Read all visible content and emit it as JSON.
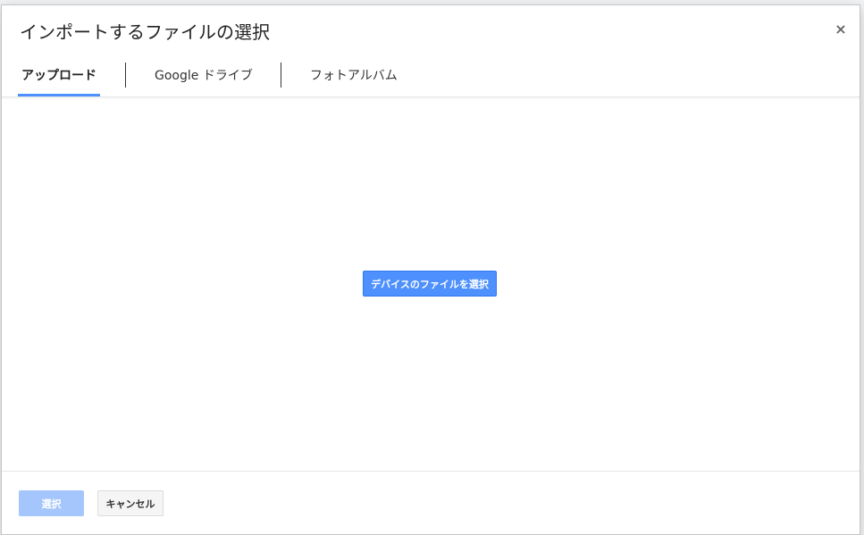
{
  "dialog": {
    "title": "インポートするファイルの選択",
    "close_label": "×",
    "tabs": [
      {
        "label": "アップロード",
        "active": true
      },
      {
        "label": "Google ドライブ",
        "active": false
      },
      {
        "label": "フォトアルバム",
        "active": false
      }
    ],
    "select_device_file_label": "デバイスのファイルを選択",
    "footer": {
      "select_label": "選択",
      "cancel_label": "キャンセル"
    }
  },
  "colors": {
    "accent": "#4d90fe",
    "accent_disabled": "#a5c6fc"
  }
}
